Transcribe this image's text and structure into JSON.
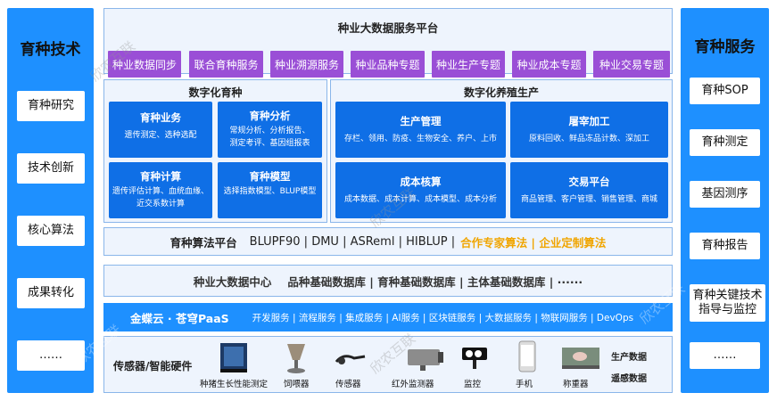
{
  "left": {
    "title": "育种技术",
    "items": [
      "育种研究",
      "技术创新",
      "核心算法",
      "成果转化",
      "……"
    ]
  },
  "right": {
    "title": "育种服务",
    "items": [
      "育种SOP",
      "育种测定",
      "基因测序",
      "育种报告",
      "育种关键技术指导与监控",
      "……"
    ]
  },
  "platform": {
    "title": "种业大数据服务平台",
    "buttons": [
      "种业数据同步",
      "联合育种服务",
      "种业溯源服务",
      "种业品种专题",
      "种业生产专题",
      "种业成本专题",
      "种业交易专题"
    ]
  },
  "digital_breeding": {
    "title": "数字化育种",
    "cards": [
      {
        "title": "育种业务",
        "desc": "遗传测定、选种选配"
      },
      {
        "title": "育种分析",
        "desc": "常规分析、分析报告、测定考评、基因组报表"
      },
      {
        "title": "育种计算",
        "desc": "遗传评估计算、血统血缘、近交系数计算"
      },
      {
        "title": "育种模型",
        "desc": "选择指数模型、BLUP模型"
      }
    ]
  },
  "digital_production": {
    "title": "数字化养殖生产",
    "cards": [
      {
        "title": "生产管理",
        "desc": "存栏、领用、防疫、生物安全、养户、上市"
      },
      {
        "title": "屠宰加工",
        "desc": "原料回收、鲜品冻品计数、深加工"
      },
      {
        "title": "成本核算",
        "desc": "成本数据、成本计算、成本模型、成本分析"
      },
      {
        "title": "交易平台",
        "desc": "商品管理、客户管理、销售管理、商城"
      }
    ]
  },
  "algorithm": {
    "label": "育种算法平台",
    "items": "BLUPF90 | DMU | ASReml | HIBLUP |",
    "highlight": "合作专家算法 | 企业定制算法",
    "highlight_color": "#f0a500"
  },
  "bigdata": {
    "label": "种业大数据中心",
    "items": "品种基础数据库 | 育种基础数据库 | 主体基础数据库 | ······"
  },
  "paas": {
    "label": "金蝶云 · 苍穹PaaS",
    "items": "开发服务 | 流程服务 | 集成服务 | AI服务 | 区块链服务 | 大数据服务 | 物联网服务 | DevOps"
  },
  "hardware": {
    "label": "传感器/智能硬件",
    "devices": [
      {
        "icon": "growth-tester-icon",
        "label": "种猪生长性能测定"
      },
      {
        "icon": "feeder-icon",
        "label": "饲喂器"
      },
      {
        "icon": "sensor-icon",
        "label": "传感器"
      },
      {
        "icon": "infrared-camera-icon",
        "label": "红外监测器"
      },
      {
        "icon": "surveillance-camera-icon",
        "label": "监控"
      },
      {
        "icon": "phone-icon",
        "label": "手机"
      },
      {
        "icon": "scale-icon",
        "label": "称重器"
      }
    ],
    "data_labels": [
      "生产数据",
      "遥感数据"
    ]
  },
  "watermark": "欣农互联",
  "colors": {
    "side": "#1e90ff",
    "purple": "#9a4fd6",
    "card": "#0f6fe6",
    "panel": "#eef4fd"
  }
}
